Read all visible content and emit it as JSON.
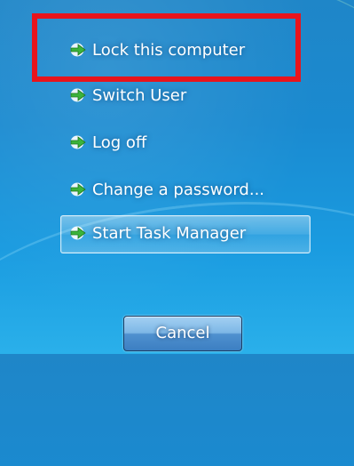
{
  "options": [
    {
      "label": "Lock this computer",
      "icon": "green-arrow-icon"
    },
    {
      "label": "Switch User",
      "icon": "green-arrow-icon"
    },
    {
      "label": "Log off",
      "icon": "green-arrow-icon"
    },
    {
      "label": "Change a password...",
      "icon": "green-arrow-icon"
    },
    {
      "label": "Start Task Manager",
      "icon": "green-arrow-icon"
    }
  ],
  "cancel_label": "Cancel",
  "colors": {
    "background": "#1a8ad0",
    "highlight_box": "#e8141c",
    "arrow": "#3bb33b"
  }
}
